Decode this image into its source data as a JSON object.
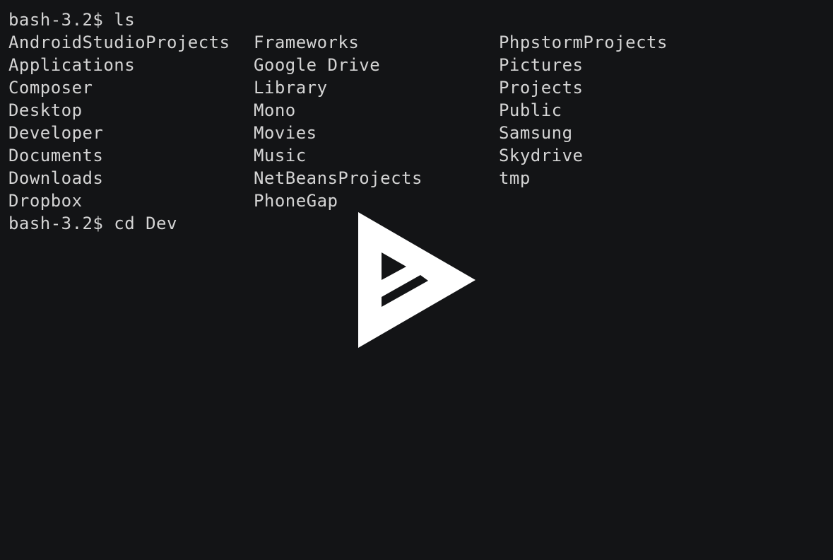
{
  "terminal": {
    "prompt_1": "bash-3.2$ ls",
    "listing": [
      "AndroidStudioProjects",
      "Applications",
      "Composer",
      "Desktop",
      "Developer",
      "Documents",
      "Downloads",
      "Dropbox",
      "Frameworks",
      "Google Drive",
      "Library",
      "Mono",
      "Movies",
      "Music",
      "NetBeansProjects",
      "PhoneGap",
      "PhpstormProjects",
      "Pictures",
      "Projects",
      "Public",
      "Samsung",
      "Skydrive",
      "tmp"
    ],
    "prompt_2": "bash-3.2$ cd Dev"
  },
  "overlay": {
    "icon": "asciinema-play-icon",
    "color": "#ffffff"
  },
  "colors": {
    "background": "#131416",
    "text": "#d4d4d4"
  }
}
